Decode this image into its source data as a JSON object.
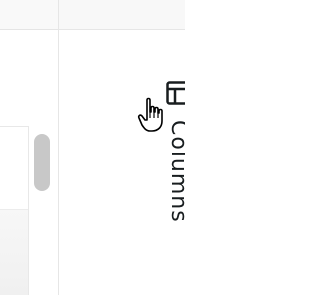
{
  "side_bar": {
    "columns_tab": {
      "label": "Columns",
      "icon": "columns-grid-icon"
    }
  },
  "cursor": {
    "icon": "hand-pointer-icon"
  },
  "colors": {
    "text": "#181d1f",
    "border": "#e6e6e6",
    "scroll_thumb": "#c8c8c8"
  }
}
